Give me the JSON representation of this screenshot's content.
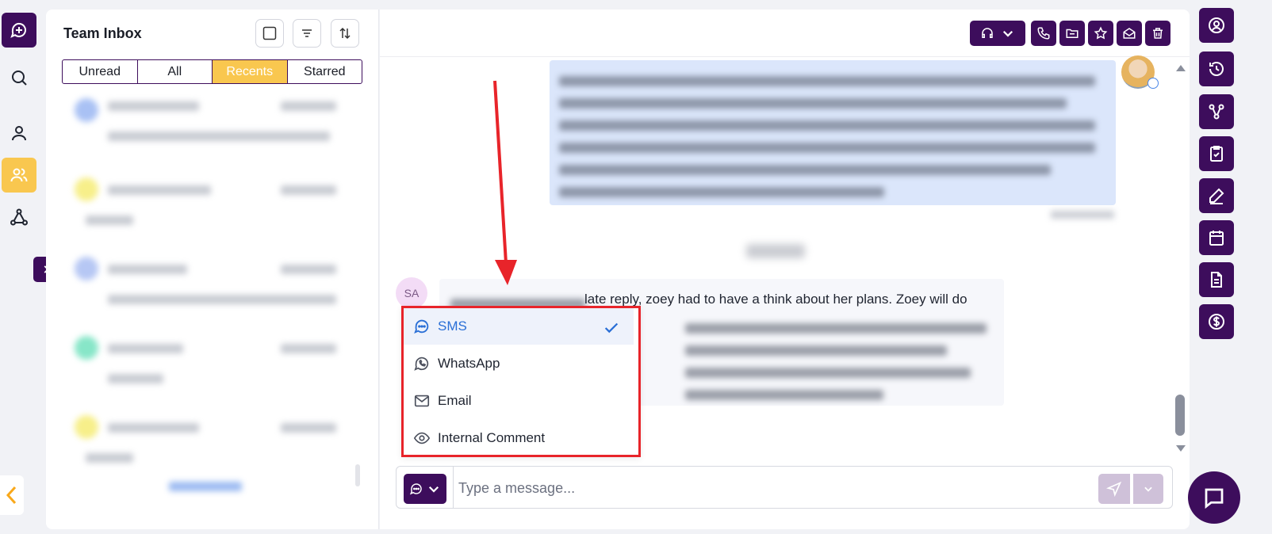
{
  "inbox": {
    "title": "Team Inbox",
    "tabs": [
      {
        "label": "Unread"
      },
      {
        "label": "All"
      },
      {
        "label": "Recents"
      },
      {
        "label": "Starred"
      }
    ],
    "active_tab": "Recents"
  },
  "conversation": {
    "incoming_avatar_initials": "SA",
    "incoming_visible_text": "late reply, zoey had to have a think about her plans. Zoey will do"
  },
  "channel_menu": {
    "items": [
      {
        "label": "SMS",
        "icon": "sms-icon",
        "selected": true
      },
      {
        "label": "WhatsApp",
        "icon": "whatsapp-icon",
        "selected": false
      },
      {
        "label": "Email",
        "icon": "email-icon",
        "selected": false
      },
      {
        "label": "Internal Comment",
        "icon": "eye-icon",
        "selected": false
      }
    ]
  },
  "composer": {
    "placeholder": "Type a message..."
  },
  "colors": {
    "brand_purple": "#3d0d5c",
    "accent_yellow": "#f9c74f",
    "annotation_red": "#e8242a",
    "selected_blue": "#2a6fd6"
  }
}
